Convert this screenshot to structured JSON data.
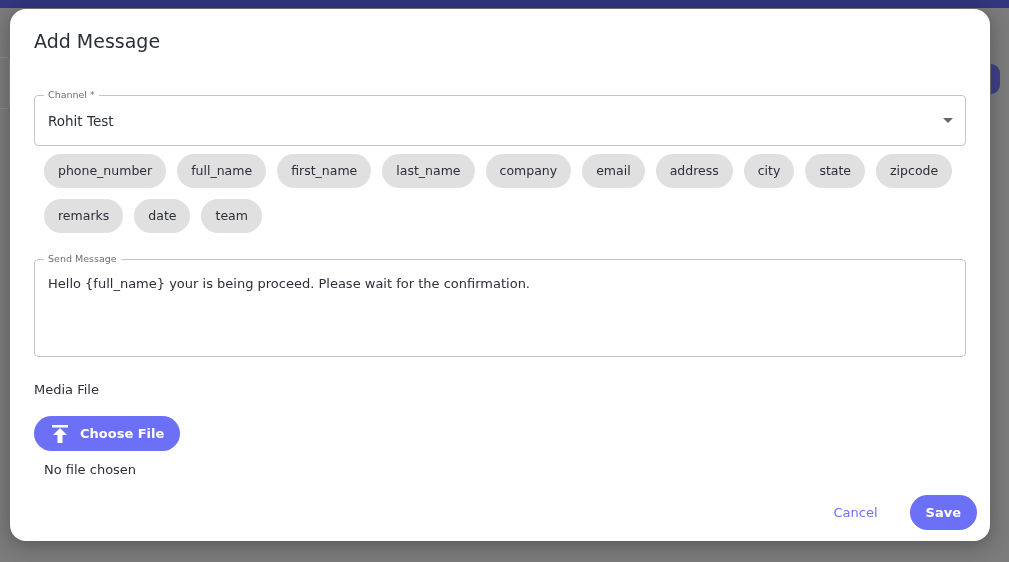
{
  "dialog": {
    "title": "Add Message",
    "channel": {
      "label": "Channel *",
      "value": "Rohit Test"
    },
    "variables": [
      "phone_number",
      "full_name",
      "first_name",
      "last_name",
      "company",
      "email",
      "address",
      "city",
      "state",
      "zipcode",
      "remarks",
      "date",
      "team"
    ],
    "message": {
      "label": "Send Message",
      "value": "Hello {full_name} your is being proceed. Please wait for the confirmation."
    },
    "media": {
      "label": "Media File",
      "button": "Choose File",
      "status": "No file chosen"
    },
    "actions": [
      {
        "label": "Cancel",
        "kind": "text"
      },
      {
        "label": "Save",
        "kind": "filled"
      }
    ]
  }
}
